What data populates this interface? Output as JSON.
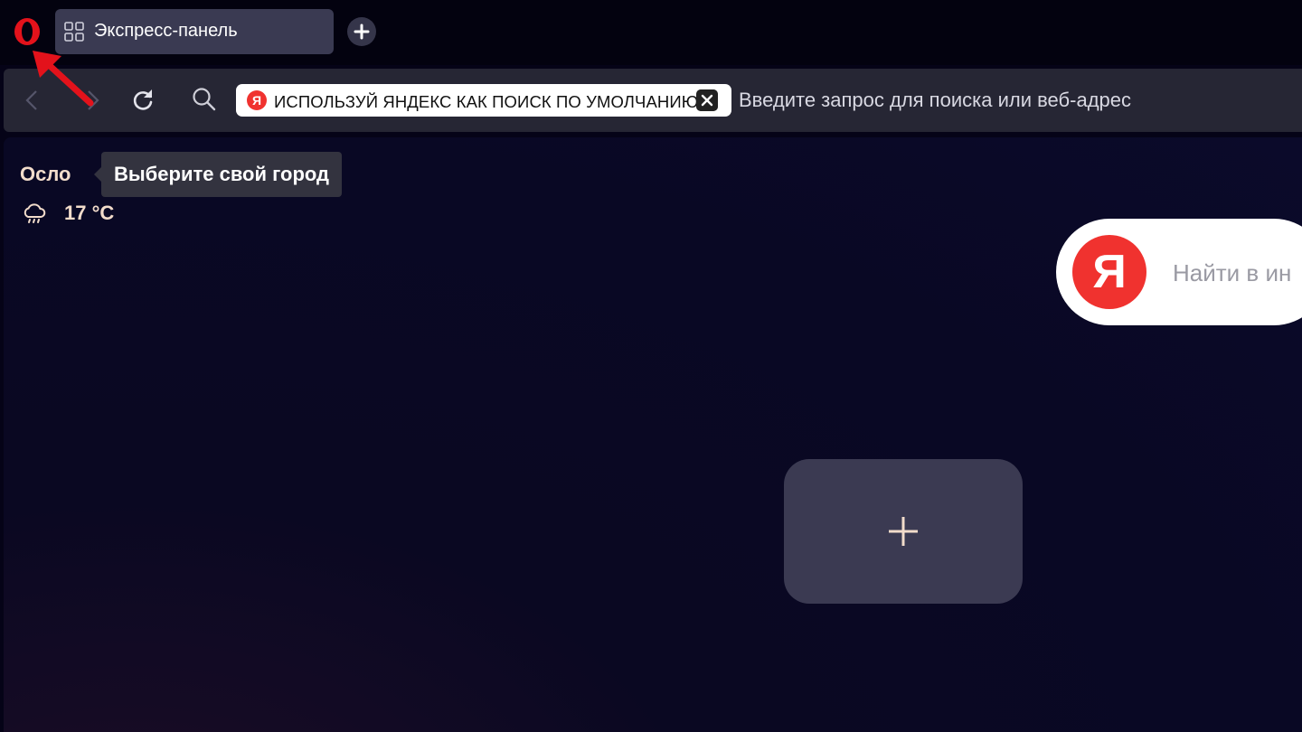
{
  "browser": {
    "logo_icon": "opera-logo-icon",
    "brand_color": "#e3121b"
  },
  "tabs": [
    {
      "title": "Экспресс-панель",
      "icon": "speed-dial-grid-icon",
      "active": true
    }
  ],
  "tabstrip": {
    "new_tab_icon": "plus-icon"
  },
  "annotation": {
    "icon": "red-arrow-icon",
    "color": "#e3121b"
  },
  "toolbar": {
    "back_icon": "chevron-left-icon",
    "forward_icon": "chevron-right-icon",
    "reload_icon": "reload-icon",
    "search_icon": "search-icon",
    "promo": {
      "badge": "Я",
      "text": "ИСПОЛЬЗУЙ ЯНДЕКС КАК ПОИСК ПО УМОЛЧАНИЮ",
      "close_icon": "close-icon"
    },
    "address_placeholder": "Введите запрос для поиска или веб-адрес"
  },
  "weather": {
    "city": "Осло",
    "tooltip": "Выберите свой город",
    "icon": "rain-cloud-icon",
    "temperature": "17 °C"
  },
  "yandex_search": {
    "logo_letter": "Я",
    "placeholder": "Найти в ин",
    "brand_color": "#f0322f"
  },
  "speed_dial": {
    "add_tile_icon": "plus-icon"
  }
}
